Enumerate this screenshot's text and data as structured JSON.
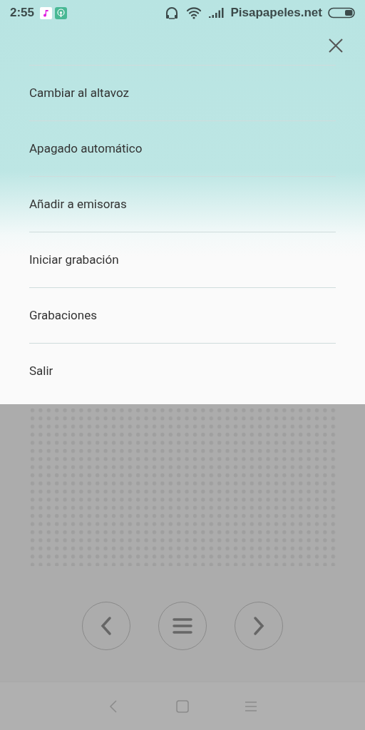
{
  "status_bar": {
    "time": "2:55",
    "carrier": "Pisapapeles.net"
  },
  "menu": {
    "items": [
      {
        "label": "Cambiar al altavoz"
      },
      {
        "label": "Apagado automático"
      },
      {
        "label": "Añadir a emisoras"
      },
      {
        "label": "Iniciar grabación"
      },
      {
        "label": "Grabaciones"
      },
      {
        "label": "Salir"
      }
    ]
  }
}
